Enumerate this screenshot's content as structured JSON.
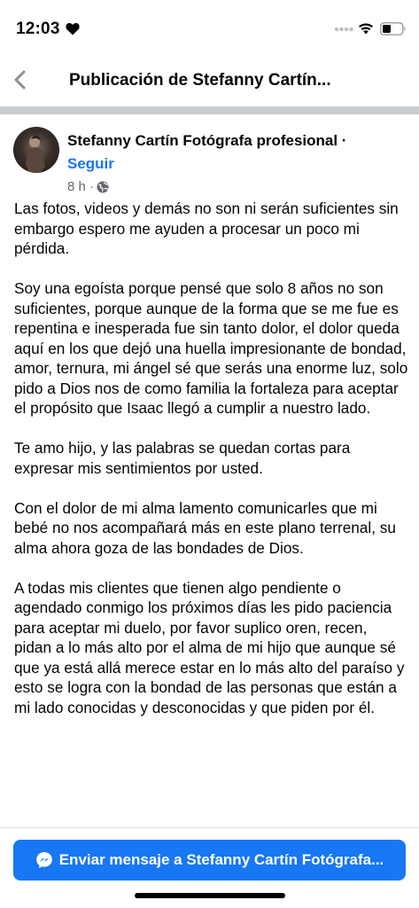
{
  "status_bar": {
    "time": "12:03",
    "icons": [
      "heart-icon",
      "signal-icon",
      "wifi-icon",
      "battery-icon"
    ]
  },
  "nav": {
    "back_icon": "chevron-left-icon",
    "title": "Publicación de Stefanny Cartín..."
  },
  "post": {
    "author": "Stefanny Cartín Fotógrafa profesional ·",
    "follow_label": "Seguir",
    "timestamp": "8 h ·",
    "privacy_icon": "globe-icon",
    "paragraphs": [
      "Las fotos, videos y demás no son ni serán suficientes sin embargo espero me ayuden a procesar un poco mi pérdida.",
      "Soy una egoísta porque pensé que solo 8 años no son suficientes, porque aunque de la forma que se me fue es repentina e inesperada fue sin tanto dolor, el dolor queda aquí en los que dejó una huella impresionante de bondad, amor, ternura, mi ángel sé que serás una enorme luz, solo pido a Dios nos de como familia la fortaleza para aceptar el propósito que Isaac llegó a cumplir a nuestro lado.",
      "Te amo hijo, y las palabras se quedan cortas para expresar mis sentimientos por usted.",
      "Con el dolor de mi alma lamento comunicarles que mi bebé no nos acompañará más en este plano terrenal, su alma ahora goza de las bondades de Dios.",
      "A todas mis clientes que tienen algo pendiente o agendado conmigo los próximos días les pido paciencia para aceptar mi duelo, por favor suplico oren, recen, pidan a lo más alto por el alma de mi hijo que aunque sé que ya está allá merece estar en lo más alto del paraíso y esto se logra con la bondad de las personas que están a mi lado conocidas y desconocidas y que piden por él."
    ]
  },
  "bottom": {
    "message_icon": "messenger-icon",
    "message_label": "Enviar mensaje a Stefanny Cartín Fotógrafa...",
    "accent_color": "#1877f2"
  }
}
